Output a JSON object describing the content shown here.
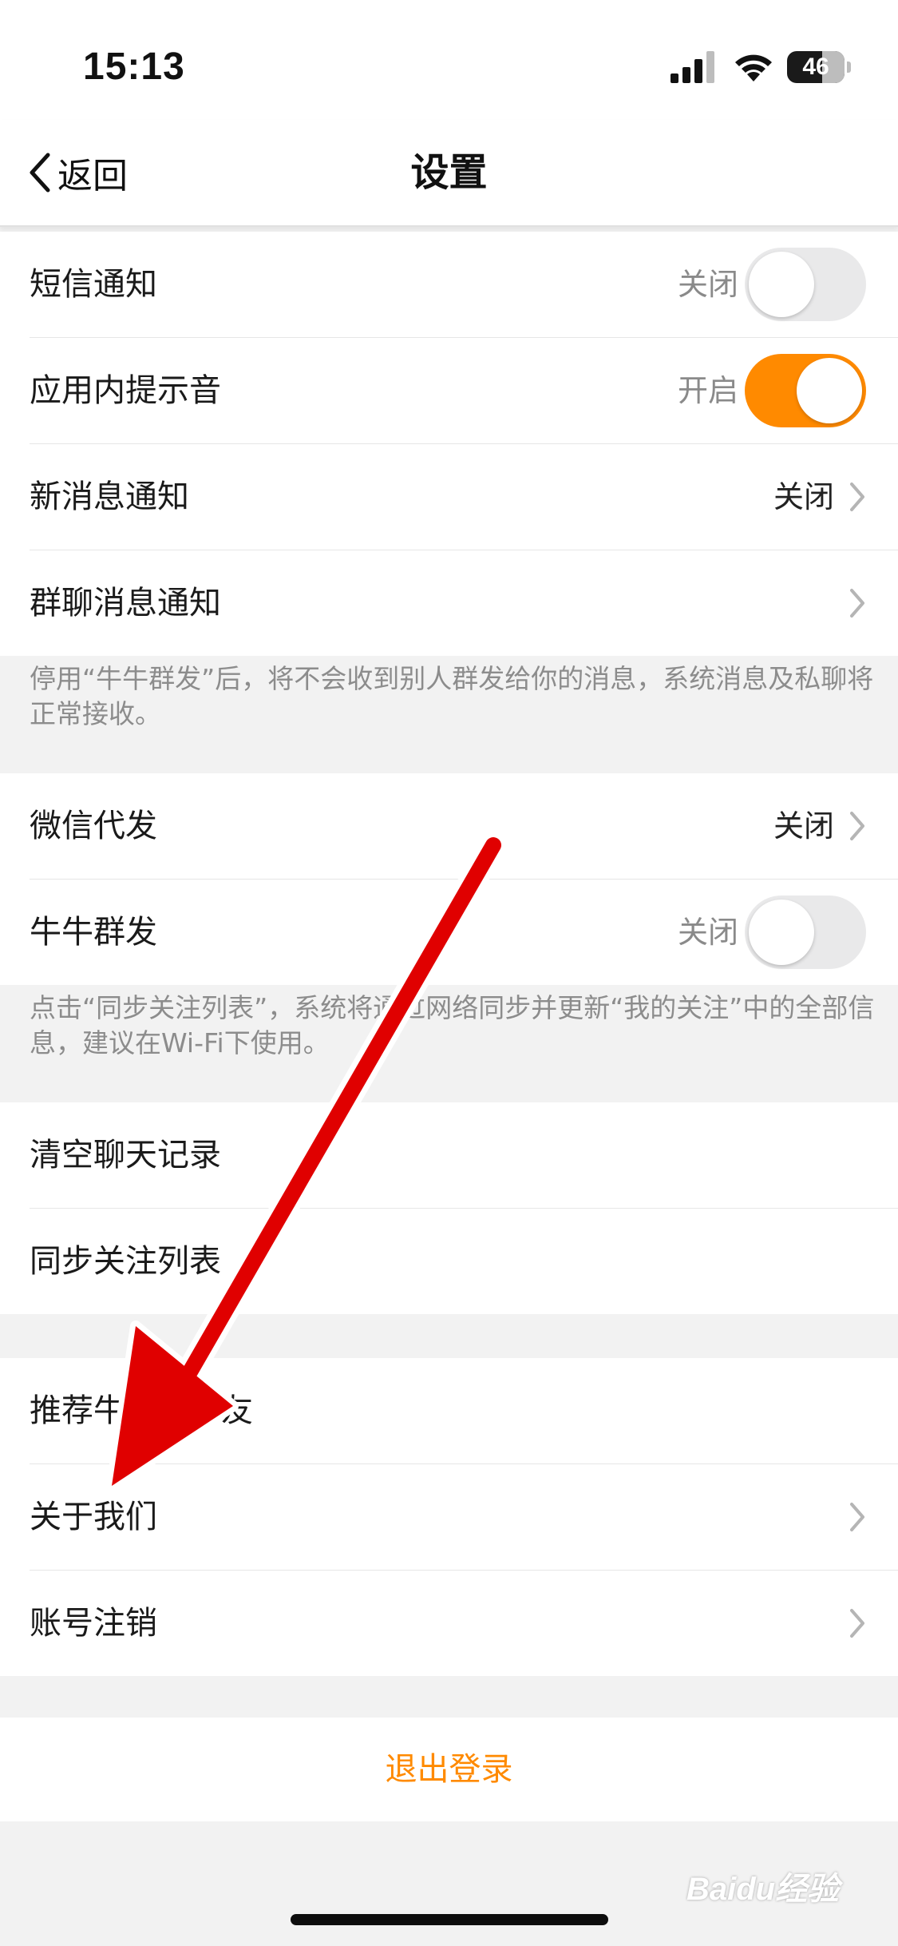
{
  "status_bar": {
    "time": "15:13",
    "battery": "46"
  },
  "nav": {
    "back_label": "返回",
    "title": "设置"
  },
  "group1": {
    "sms_notify": {
      "label": "短信通知",
      "value": "关闭"
    },
    "in_app_sound": {
      "label": "应用内提示音",
      "value": "开启"
    },
    "new_message_notify": {
      "label": "新消息通知",
      "value": "关闭"
    },
    "group_chat_notify": {
      "label": "群聊消息通知"
    }
  },
  "note1": "停用“牛牛群发”后，将不会收到别人群发给你的消息，系统消息及私聊将正常接收。",
  "group2": {
    "wechat_forward": {
      "label": "微信代发",
      "value": "关闭"
    },
    "niuniu_broadcast": {
      "label": "牛牛群发",
      "value": "关闭"
    }
  },
  "note2": "点击“同步关注列表”，系统将通过网络同步并更新“我的关注”中的全部信息，建议在Wi-Fi下使用。",
  "group3": {
    "clear_chat": {
      "label": "清空聊天记录"
    },
    "sync_follow": {
      "label": "同步关注列表"
    }
  },
  "group4": {
    "recommend": {
      "label": "推荐牛牛给好友"
    },
    "about_us": {
      "label": "关于我们"
    },
    "account_cancel": {
      "label": "账号注销"
    }
  },
  "logout_label": "退出登录",
  "watermark": "Baidu经验",
  "colors": {
    "accent": "#ff8a00",
    "annotation_arrow": "#e00000"
  }
}
